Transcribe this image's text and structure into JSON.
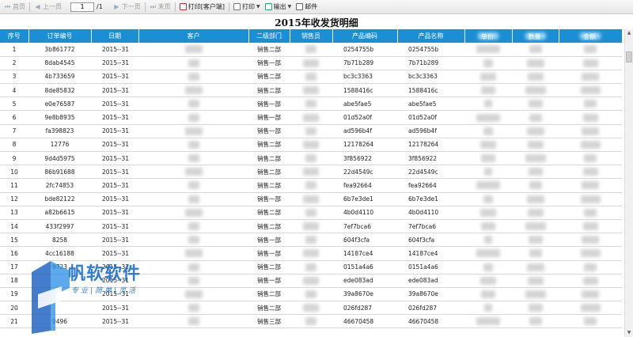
{
  "toolbar": {
    "first": "首页",
    "prev": "上一页",
    "page_value": "1",
    "page_total": "/1",
    "next": "下一页",
    "last": "末页",
    "print_client": "打印[客户端]",
    "print": "打印",
    "export": "输出",
    "mail": "邮件"
  },
  "title": "2015年收发货明细",
  "columns": [
    "序号",
    "订单编号",
    "日期",
    "客户",
    "二级部门",
    "销售员",
    "产品编码",
    "产品名称",
    "单价",
    "数量",
    "金额"
  ],
  "rows": [
    [
      "1",
      "3b861772",
      "2015--31",
      "销售二部",
      "0254755b",
      "0254755b"
    ],
    [
      "2",
      "8dab4545",
      "2015--31",
      "销售一部",
      "7b71b289",
      "7b71b289"
    ],
    [
      "3",
      "4b733659",
      "2015--31",
      "销售二部",
      "bc3c3363",
      "bc3c3363"
    ],
    [
      "4",
      "8de85832",
      "2015--31",
      "销售二部",
      "1588416c",
      "1588416c"
    ],
    [
      "5",
      "e0e76587",
      "2015--31",
      "销售一部",
      "abe5fae5",
      "abe5fae5"
    ],
    [
      "6",
      "9e8b8935",
      "2015--31",
      "销售一部",
      "01d52a0f",
      "01d52a0f"
    ],
    [
      "7",
      "fa398823",
      "2015--31",
      "销售一部",
      "ad596b4f",
      "ad596b4f"
    ],
    [
      "8",
      "12776",
      "2015--31",
      "销售二部",
      "12178264",
      "12178264"
    ],
    [
      "9",
      "9d4d5975",
      "2015--31",
      "销售二部",
      "3f856922",
      "3f856922"
    ],
    [
      "10",
      "86b91688",
      "2015--31",
      "销售二部",
      "22d4549c",
      "22d4549c"
    ],
    [
      "11",
      "2fc74853",
      "2015--31",
      "销售二部",
      "fea92664",
      "fea92664"
    ],
    [
      "12",
      "bde82122",
      "2015--31",
      "销售一部",
      "6b7e3de1",
      "6b7e3de1"
    ],
    [
      "13",
      "a82b6615",
      "2015--31",
      "销售二部",
      "4b0d4110",
      "4b0d4110"
    ],
    [
      "14",
      "433f2997",
      "2015--31",
      "销售二部",
      "7ef7bca6",
      "7ef7bca6"
    ],
    [
      "15",
      "8258",
      "2015--31",
      "销售一部",
      "604f3cfa",
      "604f3cfa"
    ],
    [
      "16",
      "4cc16188",
      "2015--31",
      "销售一部",
      "14187ce4",
      "14187ce4"
    ],
    [
      "17",
      "9723",
      "2015--31",
      "销售二部",
      "0151a4a6",
      "0151a4a6"
    ],
    [
      "18",
      "",
      "2015--31",
      "销售一部",
      "ede083ad",
      "ede083ad"
    ],
    [
      "19",
      "",
      "2015--31",
      "销售二部",
      "39a8670e",
      "39a8670e"
    ],
    [
      "20",
      "",
      "2015--31",
      "销售二部",
      "026fd287",
      "026fd287"
    ],
    [
      "21",
      "9496",
      "2015--31",
      "销售三部",
      "46670458",
      "46670458"
    ]
  ],
  "watermark": {
    "name": "帆软软件",
    "tagline": "专业|简单|灵活"
  },
  "colors": {
    "header_bg": "#1a8fd6",
    "watermark": "#1a6fd0"
  }
}
